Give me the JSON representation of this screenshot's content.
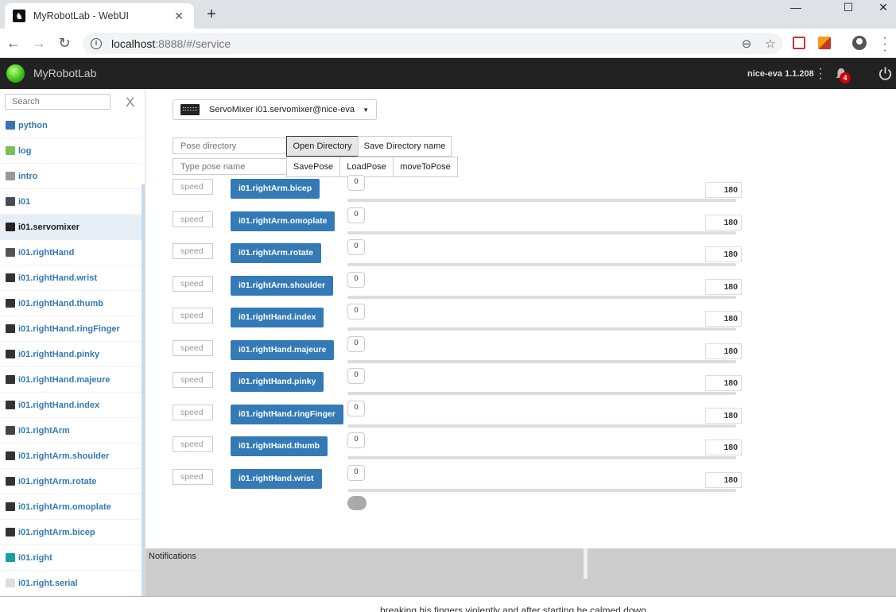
{
  "browser": {
    "tab_title": "MyRobotLab - WebUI",
    "tab_favicon": "robot-favicon",
    "close_glyph": "✕",
    "newtab_glyph": "+",
    "url_host": "localhost",
    "url_rest": ":8888/#/service"
  },
  "app": {
    "brand": "MyRobotLab",
    "version": "nice-eva 1.1.208",
    "notification_count": "4"
  },
  "sidebar": {
    "search_placeholder": "Search",
    "clear_glyph": "X",
    "items": [
      {
        "label": "python",
        "icon": "python-icon",
        "color": "#3b73b4"
      },
      {
        "label": "log",
        "icon": "log-icon",
        "color": "#7bbf5a"
      },
      {
        "label": "intro",
        "icon": "intro-icon",
        "color": "#999999"
      },
      {
        "label": "i01",
        "icon": "i01-icon",
        "color": "#444c56"
      },
      {
        "label": "i01.servomixer",
        "icon": "servomixer-icon",
        "color": "#222222",
        "active": true
      },
      {
        "label": "i01.rightHand",
        "icon": "hand-icon",
        "color": "#555555"
      },
      {
        "label": "i01.rightHand.wrist",
        "icon": "servo-icon",
        "color": "#333333"
      },
      {
        "label": "i01.rightHand.thumb",
        "icon": "servo-icon",
        "color": "#333333"
      },
      {
        "label": "i01.rightHand.ringFinger",
        "icon": "servo-icon",
        "color": "#333333"
      },
      {
        "label": "i01.rightHand.pinky",
        "icon": "servo-icon",
        "color": "#333333"
      },
      {
        "label": "i01.rightHand.majeure",
        "icon": "servo-icon",
        "color": "#333333"
      },
      {
        "label": "i01.rightHand.index",
        "icon": "servo-icon",
        "color": "#333333"
      },
      {
        "label": "i01.rightArm",
        "icon": "arm-icon",
        "color": "#444444"
      },
      {
        "label": "i01.rightArm.shoulder",
        "icon": "servo-icon",
        "color": "#333333"
      },
      {
        "label": "i01.rightArm.rotate",
        "icon": "servo-icon",
        "color": "#333333"
      },
      {
        "label": "i01.rightArm.omoplate",
        "icon": "servo-icon",
        "color": "#333333"
      },
      {
        "label": "i01.rightArm.bicep",
        "icon": "servo-icon",
        "color": "#333333"
      },
      {
        "label": "i01.right",
        "icon": "arduino-icon",
        "color": "#17a0a0"
      },
      {
        "label": "i01.right.serial",
        "icon": "serial-icon",
        "color": "#dddddd"
      }
    ]
  },
  "main": {
    "service_select": "ServoMixer  i01.servomixer@nice-eva",
    "pose_dir_placeholder": "Pose directory",
    "open_directory": "Open Directory",
    "save_directory_name": "Save Directory name",
    "pose_name_placeholder": "Type pose name",
    "save_pose": "SavePose",
    "load_pose": "LoadPose",
    "move_to_pose": "moveToPose",
    "servos": [
      {
        "name": "i01.rightArm.bicep",
        "speed": "speed",
        "min": "0",
        "max": "180"
      },
      {
        "name": "i01.rightArm.omoplate",
        "speed": "speed",
        "min": "0",
        "max": "180"
      },
      {
        "name": "i01.rightArm.rotate",
        "speed": "speed",
        "min": "0",
        "max": "180"
      },
      {
        "name": "i01.rightArm.shoulder",
        "speed": "speed",
        "min": "0",
        "max": "180"
      },
      {
        "name": "i01.rightHand.index",
        "speed": "speed",
        "min": "0",
        "max": "180"
      },
      {
        "name": "i01.rightHand.majeure",
        "speed": "speed",
        "min": "0",
        "max": "180"
      },
      {
        "name": "i01.rightHand.pinky",
        "speed": "speed",
        "min": "0",
        "max": "180"
      },
      {
        "name": "i01.rightHand.ringFinger",
        "speed": "speed",
        "min": "0",
        "max": "180"
      },
      {
        "name": "i01.rightHand.thumb",
        "speed": "speed",
        "min": "0",
        "max": "180"
      },
      {
        "name": "i01.rightHand.wrist",
        "speed": "speed",
        "min": "0",
        "max": "180"
      }
    ]
  },
  "notifications": {
    "label": "Notifications",
    "cut_text": "breaking his fingers violently and after starting he calmed down."
  },
  "colors": {
    "primary_button": "#337ab7",
    "appbar": "#222222",
    "notification_badge": "#d40000"
  }
}
